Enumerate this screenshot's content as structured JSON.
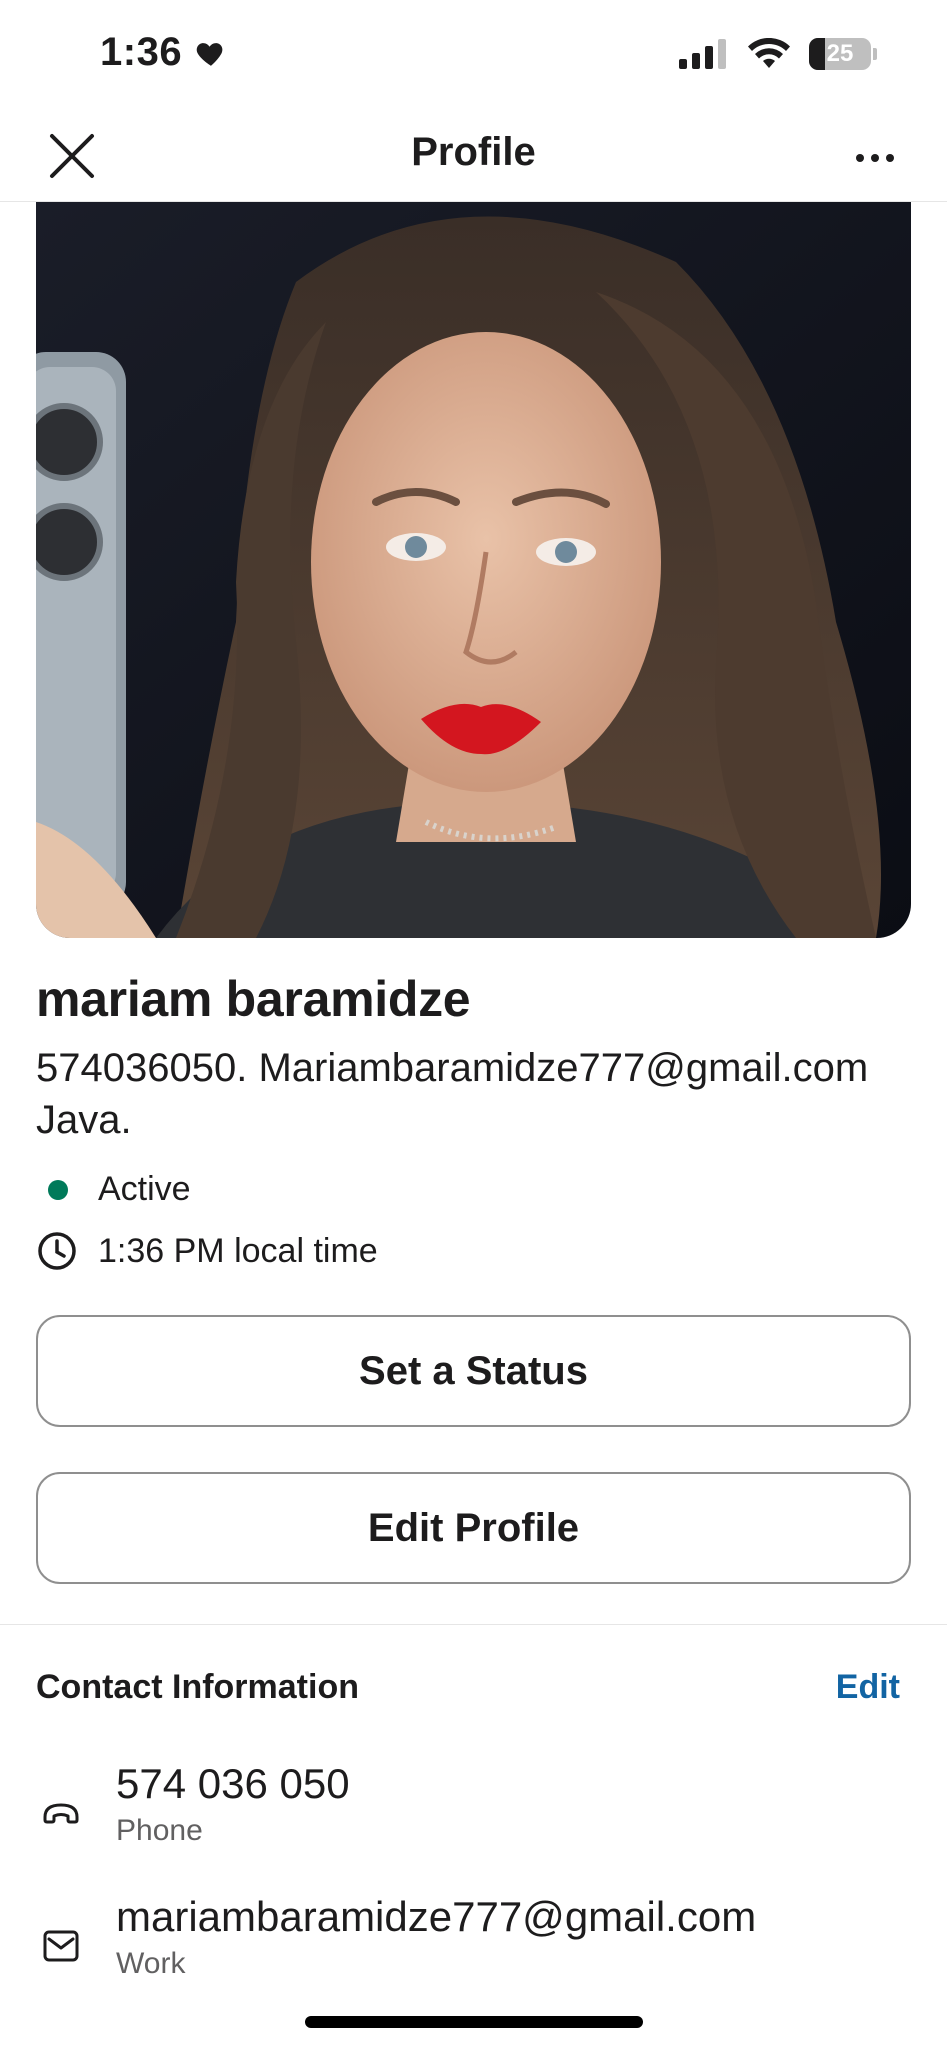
{
  "status_bar": {
    "time": "1:36",
    "battery": "25",
    "battery_level": 0.25
  },
  "nav": {
    "title": "Profile"
  },
  "profile": {
    "name": "mariam baramidze",
    "title_text": "574036050. Mariambaramidze777@gmail.com Java.",
    "presence": "Active",
    "local_time": "1:36 PM local time"
  },
  "buttons": {
    "set_status": "Set a Status",
    "edit_profile": "Edit Profile"
  },
  "contact": {
    "header": "Contact Information",
    "edit": "Edit",
    "items": [
      {
        "value": "574 036 050",
        "label": "Phone",
        "icon": "phone-icon"
      },
      {
        "value": "mariambaramidze777@gmail.com",
        "label": "Work",
        "icon": "email-icon"
      }
    ]
  },
  "colors": {
    "presence_active": "#007a5a",
    "link": "#1264a3",
    "text": "#1d1c1d",
    "secondary_text": "#616061"
  }
}
